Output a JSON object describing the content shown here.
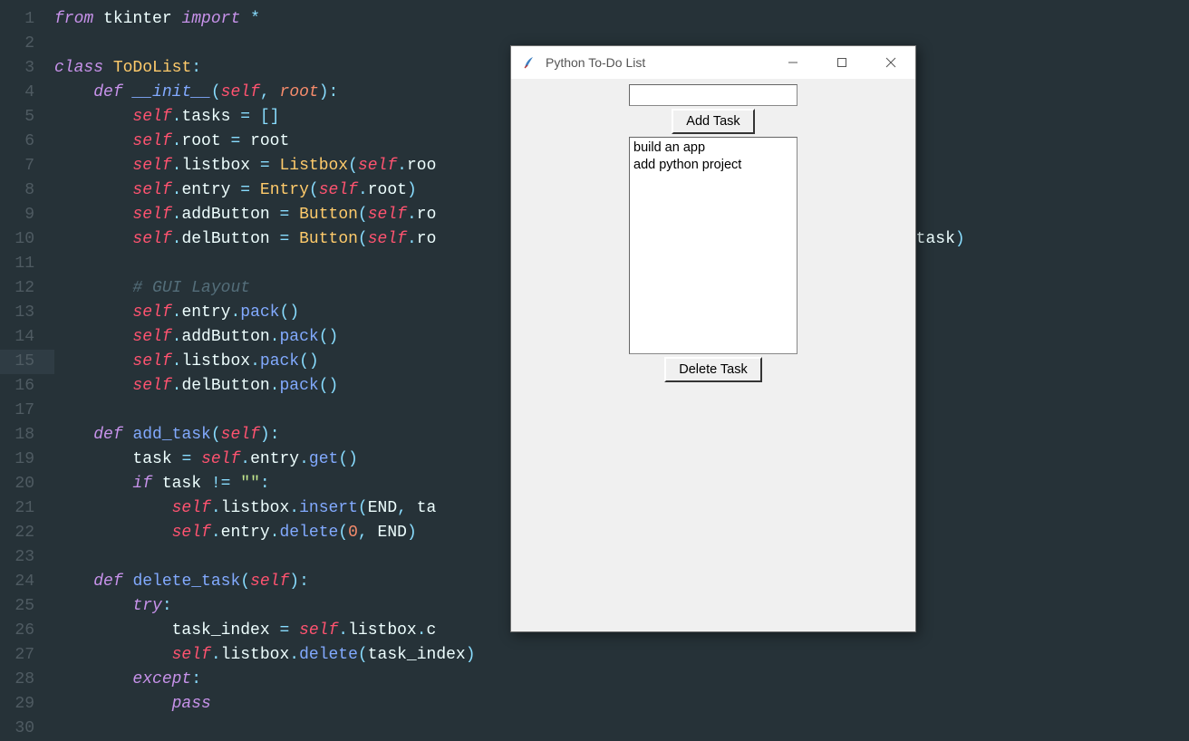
{
  "editor": {
    "line_count": 30,
    "highlighted_line": 15,
    "tokens": [
      [
        [
          "kw",
          "from"
        ],
        [
          "id",
          " tkinter "
        ],
        [
          "kw",
          "import"
        ],
        [
          "id",
          " "
        ],
        [
          "op",
          "*"
        ]
      ],
      [],
      [
        [
          "kw",
          "class"
        ],
        [
          "id",
          " "
        ],
        [
          "cls",
          "ToDoList"
        ],
        [
          "pn",
          ":"
        ]
      ],
      [
        [
          "id",
          "    "
        ],
        [
          "kw",
          "def"
        ],
        [
          "id",
          " "
        ],
        [
          "fni",
          "__init__"
        ],
        [
          "pn",
          "("
        ],
        [
          "self",
          "self"
        ],
        [
          "pn",
          ","
        ],
        [
          "id",
          " "
        ],
        [
          "prm",
          "root"
        ],
        [
          "pn",
          ")"
        ],
        [
          "pn",
          ":"
        ]
      ],
      [
        [
          "id",
          "        "
        ],
        [
          "self",
          "self"
        ],
        [
          "pn",
          "."
        ],
        [
          "id",
          "tasks "
        ],
        [
          "op",
          "="
        ],
        [
          "id",
          " "
        ],
        [
          "pn",
          "["
        ],
        [
          "pn",
          "]"
        ]
      ],
      [
        [
          "id",
          "        "
        ],
        [
          "self",
          "self"
        ],
        [
          "pn",
          "."
        ],
        [
          "id",
          "root "
        ],
        [
          "op",
          "="
        ],
        [
          "id",
          " root"
        ]
      ],
      [
        [
          "id",
          "        "
        ],
        [
          "self",
          "self"
        ],
        [
          "pn",
          "."
        ],
        [
          "id",
          "listbox "
        ],
        [
          "op",
          "="
        ],
        [
          "id",
          " "
        ],
        [
          "cl",
          "Listbox"
        ],
        [
          "pn",
          "("
        ],
        [
          "self",
          "self"
        ],
        [
          "pn",
          "."
        ],
        [
          "id",
          "roo"
        ]
      ],
      [
        [
          "id",
          "        "
        ],
        [
          "self",
          "self"
        ],
        [
          "pn",
          "."
        ],
        [
          "id",
          "entry "
        ],
        [
          "op",
          "="
        ],
        [
          "id",
          " "
        ],
        [
          "cl",
          "Entry"
        ],
        [
          "pn",
          "("
        ],
        [
          "self",
          "self"
        ],
        [
          "pn",
          "."
        ],
        [
          "id",
          "root"
        ],
        [
          "pn",
          ")"
        ]
      ],
      [
        [
          "id",
          "        "
        ],
        [
          "self",
          "self"
        ],
        [
          "pn",
          "."
        ],
        [
          "id",
          "addButton "
        ],
        [
          "op",
          "="
        ],
        [
          "id",
          " "
        ],
        [
          "cl",
          "Button"
        ],
        [
          "pn",
          "("
        ],
        [
          "self",
          "self"
        ],
        [
          "pn",
          "."
        ],
        [
          "id",
          "ro                                         d_task"
        ],
        [
          "pn",
          ")"
        ]
      ],
      [
        [
          "id",
          "        "
        ],
        [
          "self",
          "self"
        ],
        [
          "pn",
          "."
        ],
        [
          "id",
          "delButton "
        ],
        [
          "op",
          "="
        ],
        [
          "id",
          " "
        ],
        [
          "cl",
          "Button"
        ],
        [
          "pn",
          "("
        ],
        [
          "self",
          "self"
        ],
        [
          "pn",
          "."
        ],
        [
          "id",
          "ro                                         "
        ],
        [
          "pn",
          "."
        ],
        [
          "id",
          "delete_task"
        ],
        [
          "pn",
          ")"
        ]
      ],
      [],
      [
        [
          "id",
          "        "
        ],
        [
          "cmt",
          "# GUI Layout"
        ]
      ],
      [
        [
          "id",
          "        "
        ],
        [
          "self",
          "self"
        ],
        [
          "pn",
          "."
        ],
        [
          "id",
          "entry"
        ],
        [
          "pn",
          "."
        ],
        [
          "fn",
          "pack"
        ],
        [
          "pn",
          "("
        ],
        [
          "pn",
          ")"
        ]
      ],
      [
        [
          "id",
          "        "
        ],
        [
          "self",
          "self"
        ],
        [
          "pn",
          "."
        ],
        [
          "id",
          "addButton"
        ],
        [
          "pn",
          "."
        ],
        [
          "fn",
          "pack"
        ],
        [
          "pn",
          "("
        ],
        [
          "pn",
          ")"
        ]
      ],
      [
        [
          "id",
          "        "
        ],
        [
          "self",
          "self"
        ],
        [
          "pn",
          "."
        ],
        [
          "id",
          "listbox"
        ],
        [
          "pn",
          "."
        ],
        [
          "fn",
          "pack"
        ],
        [
          "pn",
          "("
        ],
        [
          "pn",
          ")"
        ]
      ],
      [
        [
          "id",
          "        "
        ],
        [
          "self",
          "self"
        ],
        [
          "pn",
          "."
        ],
        [
          "id",
          "delButton"
        ],
        [
          "pn",
          "."
        ],
        [
          "fn",
          "pack"
        ],
        [
          "pn",
          "("
        ],
        [
          "pn",
          ")"
        ]
      ],
      [],
      [
        [
          "id",
          "    "
        ],
        [
          "kw",
          "def"
        ],
        [
          "id",
          " "
        ],
        [
          "fn",
          "add_task"
        ],
        [
          "pn",
          "("
        ],
        [
          "self",
          "self"
        ],
        [
          "pn",
          ")"
        ],
        [
          "pn",
          ":"
        ]
      ],
      [
        [
          "id",
          "        task "
        ],
        [
          "op",
          "="
        ],
        [
          "id",
          " "
        ],
        [
          "self",
          "self"
        ],
        [
          "pn",
          "."
        ],
        [
          "id",
          "entry"
        ],
        [
          "pn",
          "."
        ],
        [
          "fn",
          "get"
        ],
        [
          "pn",
          "("
        ],
        [
          "pn",
          ")"
        ]
      ],
      [
        [
          "id",
          "        "
        ],
        [
          "kw",
          "if"
        ],
        [
          "id",
          " task "
        ],
        [
          "op",
          "!="
        ],
        [
          "id",
          " "
        ],
        [
          "str",
          "\"\""
        ],
        [
          "pn",
          ":"
        ]
      ],
      [
        [
          "id",
          "            "
        ],
        [
          "self",
          "self"
        ],
        [
          "pn",
          "."
        ],
        [
          "id",
          "listbox"
        ],
        [
          "pn",
          "."
        ],
        [
          "fn",
          "insert"
        ],
        [
          "pn",
          "("
        ],
        [
          "id",
          "END"
        ],
        [
          "pn",
          ","
        ],
        [
          "id",
          " ta"
        ]
      ],
      [
        [
          "id",
          "            "
        ],
        [
          "self",
          "self"
        ],
        [
          "pn",
          "."
        ],
        [
          "id",
          "entry"
        ],
        [
          "pn",
          "."
        ],
        [
          "fn",
          "delete"
        ],
        [
          "pn",
          "("
        ],
        [
          "num",
          "0"
        ],
        [
          "pn",
          ","
        ],
        [
          "id",
          " END"
        ],
        [
          "pn",
          ")"
        ]
      ],
      [],
      [
        [
          "id",
          "    "
        ],
        [
          "kw",
          "def"
        ],
        [
          "id",
          " "
        ],
        [
          "fn",
          "delete_task"
        ],
        [
          "pn",
          "("
        ],
        [
          "self",
          "self"
        ],
        [
          "pn",
          ")"
        ],
        [
          "pn",
          ":"
        ]
      ],
      [
        [
          "id",
          "        "
        ],
        [
          "kw",
          "try"
        ],
        [
          "pn",
          ":"
        ]
      ],
      [
        [
          "id",
          "            task_index "
        ],
        [
          "op",
          "="
        ],
        [
          "id",
          " "
        ],
        [
          "self",
          "self"
        ],
        [
          "pn",
          "."
        ],
        [
          "id",
          "listbox"
        ],
        [
          "pn",
          "."
        ],
        [
          "id",
          "c"
        ]
      ],
      [
        [
          "id",
          "            "
        ],
        [
          "self",
          "self"
        ],
        [
          "pn",
          "."
        ],
        [
          "id",
          "listbox"
        ],
        [
          "pn",
          "."
        ],
        [
          "fn",
          "delete"
        ],
        [
          "pn",
          "("
        ],
        [
          "id",
          "task_index"
        ],
        [
          "pn",
          ")"
        ]
      ],
      [
        [
          "id",
          "        "
        ],
        [
          "kw",
          "except"
        ],
        [
          "pn",
          ":"
        ]
      ],
      [
        [
          "id",
          "            "
        ],
        [
          "kw",
          "pass"
        ]
      ],
      []
    ]
  },
  "tkwindow": {
    "title": "Python To-Do List",
    "add_button": "Add Task",
    "delete_button": "Delete Task",
    "entry_value": "",
    "list_items": [
      "build an app",
      "add python project"
    ]
  }
}
